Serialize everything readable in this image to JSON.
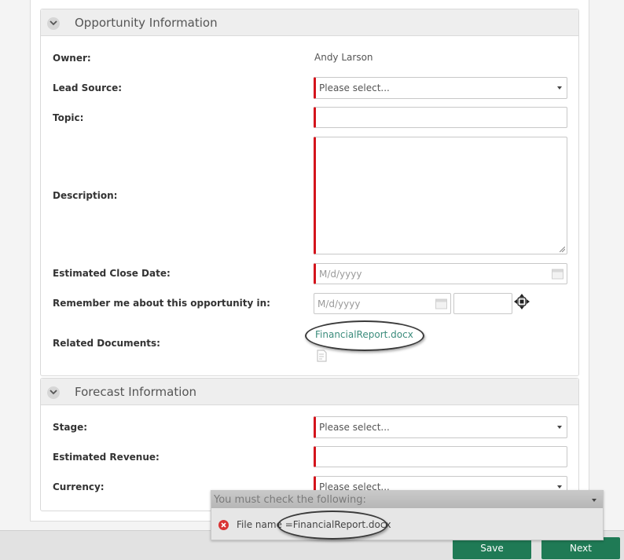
{
  "opportunity_section": {
    "title": "Opportunity Information",
    "owner_label": "Owner:",
    "owner_value": "Andy Larson",
    "lead_source_label": "Lead Source:",
    "lead_source_value": "Please select...",
    "topic_label": "Topic:",
    "topic_value": "",
    "description_label": "Description:",
    "description_value": "",
    "close_date_label": "Estimated Close Date:",
    "close_date_placeholder": "M/d/yyyy",
    "remember_label": "Remember me about this opportunity in:",
    "remember_date_placeholder": "M/d/yyyy",
    "remember_time_value": "",
    "documents_label": "Related Documents:",
    "document_link": "FinancialReport.docx"
  },
  "forecast_section": {
    "title": "Forecast Information",
    "stage_label": "Stage:",
    "stage_value": "Please select...",
    "revenue_label": "Estimated Revenue:",
    "revenue_value": "",
    "currency_label": "Currency:",
    "currency_value": "Please select..."
  },
  "validation": {
    "title": "You must check the following:",
    "message": "File name =FinancialReport.docx"
  },
  "buttons": {
    "save": "Save",
    "next": "Next"
  },
  "colors": {
    "required": "#d4141c",
    "link": "#3b8c7c",
    "button": "#1f7a55",
    "error_icon": "#d93434"
  }
}
